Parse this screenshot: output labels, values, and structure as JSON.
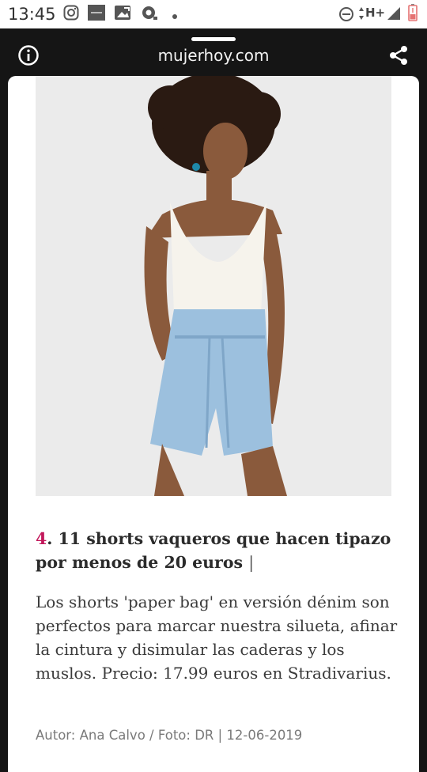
{
  "status_bar": {
    "time": "13:45",
    "network": "H+",
    "icons": [
      "instagram-icon",
      "app-thumbnail-icon",
      "image-icon",
      "assistant-icon",
      "notification-dot-icon",
      "do-not-disturb-icon",
      "data-arrows-icon",
      "signal-icon",
      "battery-low-icon"
    ],
    "battery_color": "#e57373"
  },
  "browser": {
    "domain": "mujerhoy.com",
    "icons": [
      "info-icon",
      "share-icon"
    ]
  },
  "article": {
    "image_name": "product-photo-denim-shorts",
    "headline_number": "4",
    "headline_text": ". 11 shorts vaqueros que hacen tipazo por menos de 20 euros",
    "headline_separator": "|",
    "body": "Los shorts 'paper bag' en versión dénim son perfectos para marcar nuestra silueta, afinar la cintura y disimular las caderas y los muslos. Precio: 17.99 euros en Stradivarius.",
    "byline": "Autor: Ana Calvo / Foto: DR | 12-06-2019",
    "accent_color": "#c2185b"
  }
}
